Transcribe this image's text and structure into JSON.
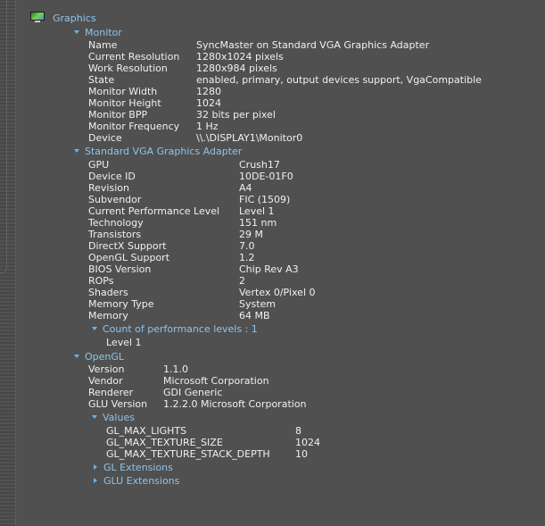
{
  "root": {
    "label": "Graphics",
    "icon": "monitor-icon"
  },
  "monitor": {
    "label": "Monitor",
    "rows": [
      {
        "key": "Name",
        "value": "SyncMaster on Standard VGA Graphics Adapter"
      },
      {
        "key": "Current Resolution",
        "value": "1280x1024 pixels"
      },
      {
        "key": "Work Resolution",
        "value": "1280x984 pixels"
      },
      {
        "key": "State",
        "value": "enabled, primary, output devices support, VgaCompatible"
      },
      {
        "key": "Monitor Width",
        "value": "1280"
      },
      {
        "key": "Monitor Height",
        "value": "1024"
      },
      {
        "key": "Monitor BPP",
        "value": "32 bits per pixel"
      },
      {
        "key": "Monitor Frequency",
        "value": "1 Hz"
      },
      {
        "key": "Device",
        "value": "\\\\.\\DISPLAY1\\Monitor0"
      }
    ]
  },
  "adapter": {
    "label": "Standard VGA Graphics Adapter",
    "rows": [
      {
        "key": "GPU",
        "value": "Crush17"
      },
      {
        "key": "Device ID",
        "value": "10DE-01F0"
      },
      {
        "key": "Revision",
        "value": "A4"
      },
      {
        "key": "Subvendor",
        "value": "FIC (1509)"
      },
      {
        "key": "Current Performance Level",
        "value": "Level 1"
      },
      {
        "key": "Technology",
        "value": "151 nm"
      },
      {
        "key": "Transistors",
        "value": "29 M"
      },
      {
        "key": "DirectX Support",
        "value": "7.0"
      },
      {
        "key": "OpenGL Support",
        "value": "1.2"
      },
      {
        "key": "BIOS Version",
        "value": "Chip Rev A3"
      },
      {
        "key": "ROPs",
        "value": "2"
      },
      {
        "key": "Shaders",
        "value": "Vertex 0/Pixel 0"
      },
      {
        "key": "Memory Type",
        "value": "System"
      },
      {
        "key": "Memory",
        "value": "64 MB"
      }
    ],
    "perf_levels": {
      "label": "Count of performance levels : 1",
      "items": [
        "Level 1"
      ]
    }
  },
  "opengl": {
    "label": "OpenGL",
    "rows": [
      {
        "key": "Version",
        "value": "1.1.0"
      },
      {
        "key": "Vendor",
        "value": "Microsoft Corporation"
      },
      {
        "key": "Renderer",
        "value": "GDI Generic"
      },
      {
        "key": "GLU Version",
        "value": "1.2.2.0 Microsoft Corporation"
      }
    ],
    "values": {
      "label": "Values",
      "rows": [
        {
          "key": "GL_MAX_LIGHTS",
          "value": "8"
        },
        {
          "key": "GL_MAX_TEXTURE_SIZE",
          "value": "1024"
        },
        {
          "key": "GL_MAX_TEXTURE_STACK_DEPTH",
          "value": "10"
        }
      ]
    },
    "gl_extensions": {
      "label": "GL Extensions"
    },
    "glu_extensions": {
      "label": "GLU Extensions"
    }
  }
}
